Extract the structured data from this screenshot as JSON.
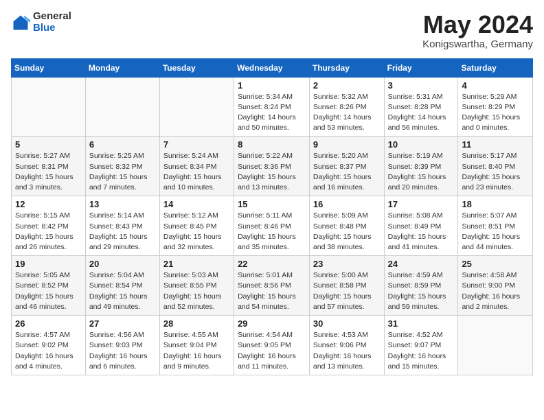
{
  "logo": {
    "general": "General",
    "blue": "Blue"
  },
  "title": "May 2024",
  "subtitle": "Konigswartha, Germany",
  "headers": [
    "Sunday",
    "Monday",
    "Tuesday",
    "Wednesday",
    "Thursday",
    "Friday",
    "Saturday"
  ],
  "weeks": [
    [
      {
        "day": "",
        "info": ""
      },
      {
        "day": "",
        "info": ""
      },
      {
        "day": "",
        "info": ""
      },
      {
        "day": "1",
        "info": "Sunrise: 5:34 AM\nSunset: 8:24 PM\nDaylight: 14 hours\nand 50 minutes."
      },
      {
        "day": "2",
        "info": "Sunrise: 5:32 AM\nSunset: 8:26 PM\nDaylight: 14 hours\nand 53 minutes."
      },
      {
        "day": "3",
        "info": "Sunrise: 5:31 AM\nSunset: 8:28 PM\nDaylight: 14 hours\nand 56 minutes."
      },
      {
        "day": "4",
        "info": "Sunrise: 5:29 AM\nSunset: 8:29 PM\nDaylight: 15 hours\nand 0 minutes."
      }
    ],
    [
      {
        "day": "5",
        "info": "Sunrise: 5:27 AM\nSunset: 8:31 PM\nDaylight: 15 hours\nand 3 minutes."
      },
      {
        "day": "6",
        "info": "Sunrise: 5:25 AM\nSunset: 8:32 PM\nDaylight: 15 hours\nand 7 minutes."
      },
      {
        "day": "7",
        "info": "Sunrise: 5:24 AM\nSunset: 8:34 PM\nDaylight: 15 hours\nand 10 minutes."
      },
      {
        "day": "8",
        "info": "Sunrise: 5:22 AM\nSunset: 8:36 PM\nDaylight: 15 hours\nand 13 minutes."
      },
      {
        "day": "9",
        "info": "Sunrise: 5:20 AM\nSunset: 8:37 PM\nDaylight: 15 hours\nand 16 minutes."
      },
      {
        "day": "10",
        "info": "Sunrise: 5:19 AM\nSunset: 8:39 PM\nDaylight: 15 hours\nand 20 minutes."
      },
      {
        "day": "11",
        "info": "Sunrise: 5:17 AM\nSunset: 8:40 PM\nDaylight: 15 hours\nand 23 minutes."
      }
    ],
    [
      {
        "day": "12",
        "info": "Sunrise: 5:15 AM\nSunset: 8:42 PM\nDaylight: 15 hours\nand 26 minutes."
      },
      {
        "day": "13",
        "info": "Sunrise: 5:14 AM\nSunset: 8:43 PM\nDaylight: 15 hours\nand 29 minutes."
      },
      {
        "day": "14",
        "info": "Sunrise: 5:12 AM\nSunset: 8:45 PM\nDaylight: 15 hours\nand 32 minutes."
      },
      {
        "day": "15",
        "info": "Sunrise: 5:11 AM\nSunset: 8:46 PM\nDaylight: 15 hours\nand 35 minutes."
      },
      {
        "day": "16",
        "info": "Sunrise: 5:09 AM\nSunset: 8:48 PM\nDaylight: 15 hours\nand 38 minutes."
      },
      {
        "day": "17",
        "info": "Sunrise: 5:08 AM\nSunset: 8:49 PM\nDaylight: 15 hours\nand 41 minutes."
      },
      {
        "day": "18",
        "info": "Sunrise: 5:07 AM\nSunset: 8:51 PM\nDaylight: 15 hours\nand 44 minutes."
      }
    ],
    [
      {
        "day": "19",
        "info": "Sunrise: 5:05 AM\nSunset: 8:52 PM\nDaylight: 15 hours\nand 46 minutes."
      },
      {
        "day": "20",
        "info": "Sunrise: 5:04 AM\nSunset: 8:54 PM\nDaylight: 15 hours\nand 49 minutes."
      },
      {
        "day": "21",
        "info": "Sunrise: 5:03 AM\nSunset: 8:55 PM\nDaylight: 15 hours\nand 52 minutes."
      },
      {
        "day": "22",
        "info": "Sunrise: 5:01 AM\nSunset: 8:56 PM\nDaylight: 15 hours\nand 54 minutes."
      },
      {
        "day": "23",
        "info": "Sunrise: 5:00 AM\nSunset: 8:58 PM\nDaylight: 15 hours\nand 57 minutes."
      },
      {
        "day": "24",
        "info": "Sunrise: 4:59 AM\nSunset: 8:59 PM\nDaylight: 15 hours\nand 59 minutes."
      },
      {
        "day": "25",
        "info": "Sunrise: 4:58 AM\nSunset: 9:00 PM\nDaylight: 16 hours\nand 2 minutes."
      }
    ],
    [
      {
        "day": "26",
        "info": "Sunrise: 4:57 AM\nSunset: 9:02 PM\nDaylight: 16 hours\nand 4 minutes."
      },
      {
        "day": "27",
        "info": "Sunrise: 4:56 AM\nSunset: 9:03 PM\nDaylight: 16 hours\nand 6 minutes."
      },
      {
        "day": "28",
        "info": "Sunrise: 4:55 AM\nSunset: 9:04 PM\nDaylight: 16 hours\nand 9 minutes."
      },
      {
        "day": "29",
        "info": "Sunrise: 4:54 AM\nSunset: 9:05 PM\nDaylight: 16 hours\nand 11 minutes."
      },
      {
        "day": "30",
        "info": "Sunrise: 4:53 AM\nSunset: 9:06 PM\nDaylight: 16 hours\nand 13 minutes."
      },
      {
        "day": "31",
        "info": "Sunrise: 4:52 AM\nSunset: 9:07 PM\nDaylight: 16 hours\nand 15 minutes."
      },
      {
        "day": "",
        "info": ""
      }
    ]
  ]
}
